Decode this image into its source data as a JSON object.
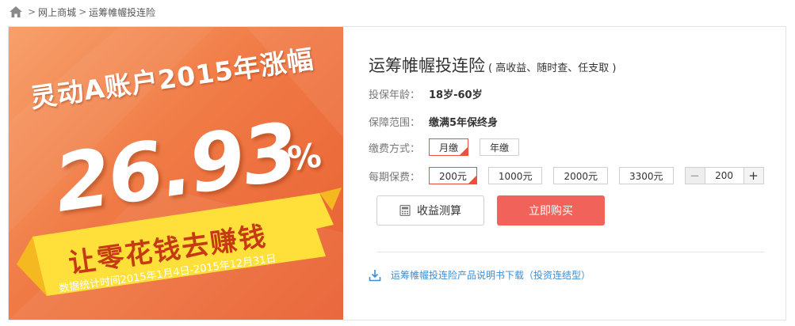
{
  "breadcrumb": {
    "home_icon": "home-icon",
    "separator": ">",
    "items": [
      "网上商城",
      "运筹帷幄投连险"
    ]
  },
  "banner": {
    "headline": "灵动A账户2015年涨幅",
    "rate": "26.93",
    "rate_unit": "%",
    "slogan": "让零花钱去赚钱",
    "note": "数据统计时间2015年1月4日-2015年12月31日",
    "colors": {
      "bg_start": "#f7a06b",
      "bg_end": "#e85f31",
      "ribbon": "#ffe03a"
    }
  },
  "product": {
    "title": "运筹帷幄投连险",
    "subtitle": "( 高收益、随时查、任支取 )",
    "age_label": "投保年龄：",
    "age_value": "18岁-60岁",
    "coverage_label": "保障范围：",
    "coverage_value": "缴满5年保终身",
    "pay_method_label": "缴费方式：",
    "pay_methods": [
      {
        "label": "月缴",
        "selected": true
      },
      {
        "label": "年缴",
        "selected": false
      }
    ],
    "premium_label": "每期保费：",
    "premiums": [
      {
        "label": "200元",
        "selected": true
      },
      {
        "label": "1000元",
        "selected": false
      },
      {
        "label": "2000元",
        "selected": false
      },
      {
        "label": "3300元",
        "selected": false
      }
    ],
    "stepper": {
      "minus": "−",
      "value": "200",
      "plus": "+"
    },
    "calc_button": "收益测算",
    "buy_button": "立即购买",
    "download_text": "运筹帷幄投连险产品说明书下载（投资连结型）",
    "colors": {
      "accent": "#f0625a",
      "link": "#3a8ed6",
      "selected_border": "#e85040"
    }
  }
}
